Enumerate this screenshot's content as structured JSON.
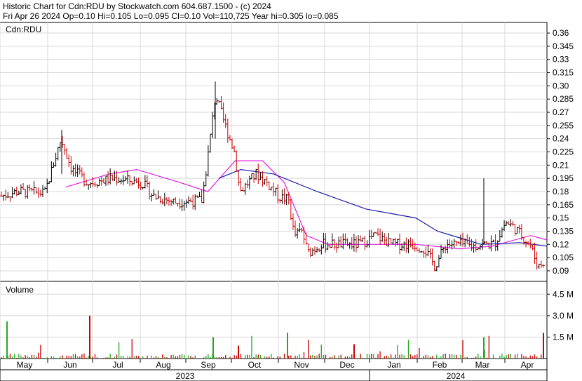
{
  "header": {
    "line1": "Historic Chart for Cdn:RDU by Stockwatch.com 604.687.1500 - (c) 2024",
    "line2": "Fri Apr 26 2024   Op=0.10  Hi=0.105  Lo=0.095  Cl=0.10  Vol=110,725  Year hi=0.305  lo=0.085"
  },
  "colors": {
    "bar_up": "#000000",
    "bar_down": "#cc0000",
    "ma_short": "#e020e0",
    "ma_long": "#1a1aaa",
    "vol_up": "#22aa22",
    "vol_down": "#cc0000",
    "grid": "#d8d8d8"
  },
  "chart_data": [
    {
      "type": "ohlc",
      "title": "Cdn:RDU",
      "ylim": [
        0.078,
        0.372
      ],
      "y_ticks": [
        "0.36",
        "0.345",
        "0.33",
        "0.315",
        "0.30",
        "0.285",
        "0.27",
        "0.255",
        "0.24",
        "0.225",
        "0.21",
        "0.195",
        "0.18",
        "0.165",
        "0.15",
        "0.135",
        "0.12",
        "0.105",
        "0.09"
      ],
      "x_month_labels": [
        "May",
        "Jun",
        "Jul",
        "Aug",
        "Sep",
        "Oct",
        "Nov",
        "Dec",
        "Jan",
        "Feb",
        "Mar",
        "Apr"
      ],
      "x_year_labels": [
        "2023",
        "2024"
      ],
      "grid": true,
      "close_anchors": {
        "May": 0.175,
        "Jun": 0.215,
        "Jul": 0.195,
        "Aug": 0.17,
        "Sep-early": 0.275,
        "Sep-late": 0.23,
        "Oct": 0.185,
        "Nov": 0.115,
        "Dec": 0.12,
        "Jan": 0.12,
        "Feb": 0.11,
        "Mar": 0.12,
        "Apr-mid": 0.14,
        "Apr-end": 0.1
      },
      "series": [
        {
          "name": "short moving average",
          "points": [
            [
              0.12,
              0.185
            ],
            [
              0.2,
              0.2
            ],
            [
              0.25,
              0.205
            ],
            [
              0.33,
              0.19
            ],
            [
              0.38,
              0.18
            ],
            [
              0.43,
              0.215
            ],
            [
              0.48,
              0.215
            ],
            [
              0.52,
              0.19
            ],
            [
              0.56,
              0.13
            ],
            [
              0.6,
              0.12
            ],
            [
              0.68,
              0.12
            ],
            [
              0.76,
              0.12
            ],
            [
              0.84,
              0.115
            ],
            [
              0.9,
              0.118
            ],
            [
              0.97,
              0.13
            ],
            [
              1.0,
              0.125
            ]
          ]
        },
        {
          "name": "long moving average",
          "points": [
            [
              0.4,
              0.195
            ],
            [
              0.44,
              0.205
            ],
            [
              0.5,
              0.2
            ],
            [
              0.58,
              0.18
            ],
            [
              0.67,
              0.16
            ],
            [
              0.76,
              0.15
            ],
            [
              0.8,
              0.135
            ],
            [
              0.88,
              0.12
            ],
            [
              0.95,
              0.122
            ],
            [
              1.0,
              0.118
            ]
          ]
        }
      ],
      "year_summary": {
        "year_hi": 0.305,
        "year_lo": 0.085
      }
    },
    {
      "type": "bar",
      "title": "Volume",
      "y_ticks": [
        "4.5 M",
        "3.0 M",
        "1.5 M"
      ],
      "ylim": [
        0,
        5.2
      ],
      "spikes": {
        "May-start": 2.6,
        "Jun-mid": 3.0,
        "Sep": 1.5,
        "Oct": 0.9,
        "Nov": 1.8,
        "Dec": 1.0,
        "Mar": 1.5,
        "Apr-end": 1.8
      }
    }
  ]
}
